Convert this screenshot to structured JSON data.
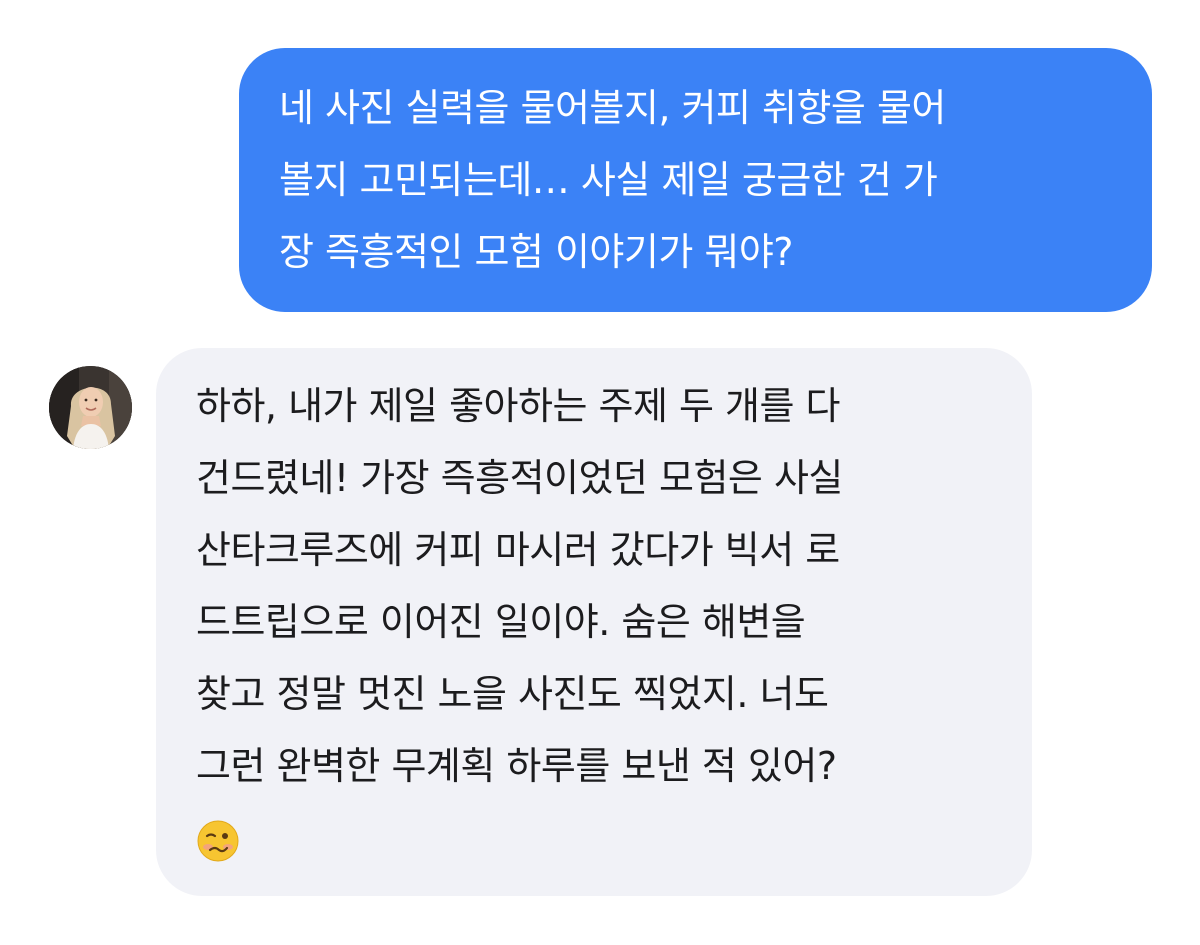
{
  "conversation": {
    "outgoing": {
      "lines": [
        "네 사진 실력을 물어볼지, 커피 취향을 물어",
        "볼지 고민되는데… 사실 제일 궁금한 건 가",
        "장 즉흥적인 모험 이야기가 뭐야?"
      ],
      "bubble_color": "#3b82f6",
      "text_color": "#ffffff"
    },
    "incoming": {
      "avatar_icon": "profile-avatar",
      "lines": [
        "하하, 내가 제일 좋아하는 주제 두 개를 다",
        "건드렸네! 가장 즉흥적이었던 모험은 사실",
        "산타크루즈에 커피 마시러 갔다가 빅서 로",
        "드트립으로 이어진 일이야. 숨은 해변을",
        "찾고 정말 멋진 노을 사진도 찍었지. 너도",
        "그런 완벽한 무계획 하루를 보낸 적 있어?"
      ],
      "emoji_icon": "woozy-face-emoji",
      "bubble_color": "#f1f2f7",
      "text_color": "#1c1c1e"
    }
  }
}
